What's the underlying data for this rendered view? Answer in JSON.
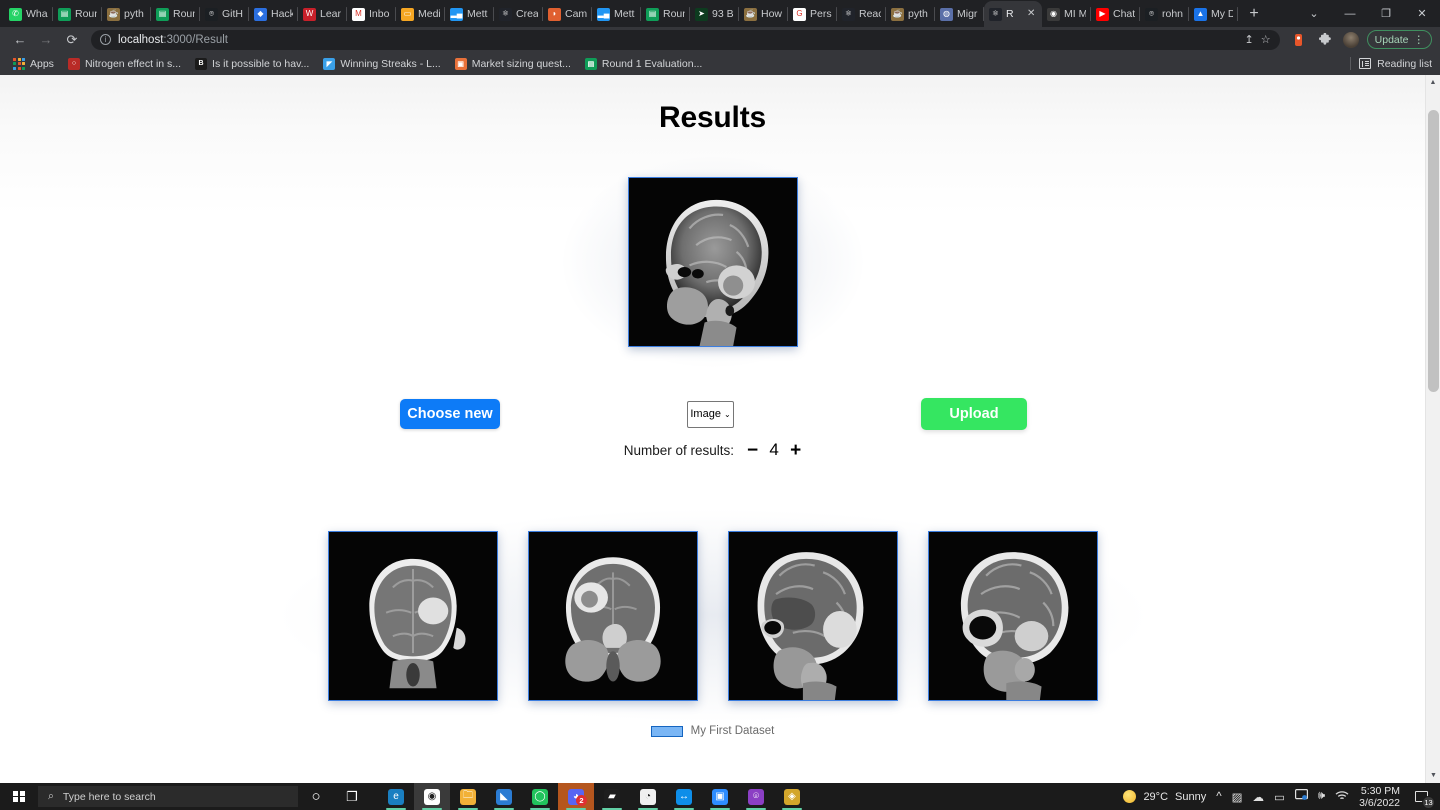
{
  "browser": {
    "tabs": [
      {
        "label": "Wha",
        "icon": "whatsapp-icon",
        "color": "#25D366",
        "glyph": "✆",
        "active": false
      },
      {
        "label": "Roun",
        "icon": "sheets-icon",
        "color": "#0f9d58",
        "glyph": "▤",
        "active": false
      },
      {
        "label": "pyth",
        "icon": "python-docs-icon",
        "color": "#8b6f3f",
        "glyph": "☕",
        "active": false
      },
      {
        "label": "Roun",
        "icon": "sheets-icon",
        "color": "#0f9d58",
        "glyph": "▤",
        "active": false
      },
      {
        "label": "GitH",
        "icon": "github-icon",
        "color": "#1b1f23",
        "glyph": "⌾",
        "active": false
      },
      {
        "label": "Hack",
        "icon": "hackerearth-icon",
        "color": "#2b6fe0",
        "glyph": "◆",
        "active": false
      },
      {
        "label": "Lear",
        "icon": "w3-icon",
        "color": "#c8202a",
        "glyph": "W",
        "active": false
      },
      {
        "label": "Inbo",
        "icon": "gmail-icon",
        "color": "#ffffff",
        "glyph": "M",
        "active": false
      },
      {
        "label": "Medi",
        "icon": "medium-icon",
        "color": "#f5a623",
        "glyph": "▭",
        "active": false
      },
      {
        "label": "Mett",
        "icon": "mettl-icon",
        "color": "#2196f3",
        "glyph": "▂▄",
        "active": false
      },
      {
        "label": "Crea",
        "icon": "react-icon",
        "color": "#20232a",
        "glyph": "⚛",
        "active": false
      },
      {
        "label": "Cam",
        "icon": "campus-icon",
        "color": "#e06030",
        "glyph": "◗",
        "active": false
      },
      {
        "label": "Mett",
        "icon": "mettl-icon",
        "color": "#2196f3",
        "glyph": "▂▄",
        "active": false
      },
      {
        "label": "Roun",
        "icon": "sheets-icon",
        "color": "#0f9d58",
        "glyph": "▤",
        "active": false
      },
      {
        "label": "93 B",
        "icon": "cursor-icon",
        "color": "#0d3b1f",
        "glyph": "➤",
        "active": false
      },
      {
        "label": "How",
        "icon": "python-docs-icon",
        "color": "#8b6f3f",
        "glyph": "☕",
        "active": false
      },
      {
        "label": "Pers",
        "icon": "google-icon",
        "color": "#ffffff",
        "glyph": "G",
        "active": false
      },
      {
        "label": "Reac",
        "icon": "react-icon",
        "color": "#20232a",
        "glyph": "⚛",
        "active": false
      },
      {
        "label": "pyth",
        "icon": "python-docs-icon",
        "color": "#8b6f3f",
        "glyph": "☕",
        "active": false
      },
      {
        "label": "Migr",
        "icon": "migration-icon",
        "color": "#5a6fa8",
        "glyph": "◍",
        "active": false
      },
      {
        "label": "R",
        "icon": "react-icon",
        "color": "#20232a",
        "glyph": "⚛",
        "active": true,
        "close": "✕"
      },
      {
        "label": "MI M",
        "icon": "globe-icon",
        "color": "#3a3a3a",
        "glyph": "◉",
        "active": false
      },
      {
        "label": "Chat",
        "icon": "youtube-icon",
        "color": "#ff0000",
        "glyph": "▶",
        "active": false
      },
      {
        "label": "rohn",
        "icon": "github-icon",
        "color": "#1b1f23",
        "glyph": "⌾",
        "active": false
      },
      {
        "label": "My D",
        "icon": "drive-icon",
        "color": "#1a73e8",
        "glyph": "▲",
        "active": false
      }
    ],
    "new_tab_label": "+",
    "window_controls": {
      "tab_search": "⌄",
      "minimize": "—",
      "maximize": "❐",
      "close": "✕"
    },
    "nav": {
      "back": "←",
      "forward": "→",
      "reload": "⟳"
    },
    "omnibox": {
      "host": "localhost",
      "path": ":3000/Result",
      "share_icon": "↥",
      "bookmark_icon": "☆"
    },
    "update_button": {
      "label": "Update",
      "menu": "⋮"
    },
    "extensions_icon": "🧩",
    "bookmarks": [
      {
        "label": "Apps",
        "icon": "apps-grid-icon"
      },
      {
        "label": "Nitrogen effect in s...",
        "icon": "quora-icon",
        "color": "#b92b27",
        "glyph": "○"
      },
      {
        "label": "Is it possible to hav...",
        "icon": "brainly-icon",
        "color": "#1b1b1b",
        "glyph": "B"
      },
      {
        "label": "Winning Streaks - L...",
        "icon": "twitter-icon",
        "color": "#3aa0e8",
        "glyph": "◤"
      },
      {
        "label": "Market sizing quest...",
        "icon": "slides-icon",
        "color": "#e8713a",
        "glyph": "▣"
      },
      {
        "label": "Round 1 Evaluation...",
        "icon": "sheets-icon",
        "color": "#0f9d58",
        "glyph": "▤"
      }
    ],
    "reading_list_label": "Reading list"
  },
  "page": {
    "title": "Results",
    "preview_alt": "sagittal-brain-mri-scan",
    "buttons": {
      "choose_new": "Choose new",
      "upload": "Upload"
    },
    "type_select": {
      "value": "Image",
      "chevron": "⌄",
      "options": [
        "Image"
      ]
    },
    "counter": {
      "label": "Number of results:",
      "decrement": "−",
      "value": "4",
      "increment": "+"
    },
    "results": [
      {
        "alt": "coronal-brain-mri-result-1"
      },
      {
        "alt": "coronal-brain-mri-result-2"
      },
      {
        "alt": "sagittal-brain-mri-result-3"
      },
      {
        "alt": "sagittal-brain-mri-result-4"
      }
    ],
    "dataset_label": "My First Dataset",
    "scrollbar": {
      "up": "▲",
      "down": "▼"
    }
  },
  "taskbar": {
    "search_placeholder": "Type here to search",
    "search_icon": "⌕",
    "cortana_icon": "○",
    "taskview_icon": "❐",
    "apps": [
      {
        "name": "edge-icon",
        "color": "#1a7fc1",
        "glyph": "e"
      },
      {
        "name": "chrome-icon",
        "color": "#ffffff",
        "glyph": "◉"
      },
      {
        "name": "file-explorer-icon",
        "color": "#f2b138",
        "glyph": "🗀"
      },
      {
        "name": "vscode-icon",
        "color": "#2b7cd3",
        "glyph": "◣"
      },
      {
        "name": "loading-ring-icon",
        "color": "#21c45d",
        "glyph": "◯"
      },
      {
        "name": "discord-icon",
        "color": "#5865f2",
        "glyph": "◕",
        "badge": "2"
      },
      {
        "name": "terminal-icon",
        "color": "#1e1e1e",
        "glyph": "▰"
      },
      {
        "name": "pomodoro-icon",
        "color": "#f0f0f0",
        "glyph": "◔"
      },
      {
        "name": "teamviewer-icon",
        "color": "#0e8ee9",
        "glyph": "↔"
      },
      {
        "name": "zoom-icon",
        "color": "#2d8cff",
        "glyph": "▣"
      },
      {
        "name": "github-desktop-icon",
        "color": "#8b3fc4",
        "glyph": "⌾"
      },
      {
        "name": "sublime-icon",
        "color": "#d3a62b",
        "glyph": "◈"
      }
    ],
    "tray": {
      "weather_temp": "29°C",
      "weather_desc": "Sunny",
      "chevron": "^",
      "onedrive_icon": "☁",
      "battery_icon": "▭",
      "network_icon": "▨",
      "volume_icon": "🕪",
      "wifi_icon": "◗",
      "time": "5:30 PM",
      "date": "3/6/2022",
      "notification_count": "13"
    }
  }
}
